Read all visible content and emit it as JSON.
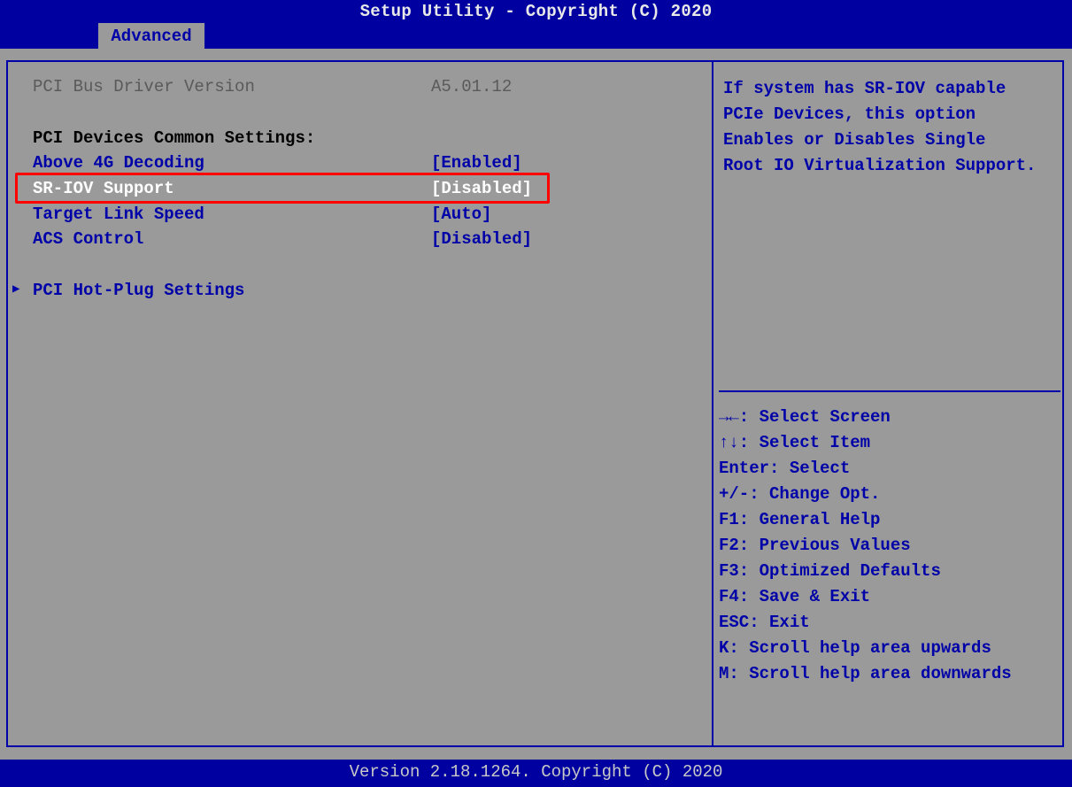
{
  "header": {
    "title": "Setup Utility - Copyright (C) 2020",
    "active_tab": "Advanced"
  },
  "main": {
    "info": {
      "label": "PCI Bus Driver Version",
      "value": "A5.01.12"
    },
    "section_heading": "PCI Devices Common Settings:",
    "settings": [
      {
        "label": "Above 4G Decoding",
        "value": "[Enabled]"
      },
      {
        "label": "SR-IOV Support",
        "value": "[Disabled]",
        "selected": true
      },
      {
        "label": "Target Link Speed",
        "value": "[Auto]"
      },
      {
        "label": "ACS Control",
        "value": "[Disabled]"
      }
    ],
    "submenu": {
      "label": "PCI Hot-Plug Settings",
      "icon": "triangle-right-icon"
    }
  },
  "help": {
    "lines": [
      "If system has SR-IOV capable",
      "PCIe Devices, this option",
      "Enables or Disables Single",
      "Root IO Virtualization Support."
    ]
  },
  "keys": [
    "→←: Select Screen",
    "↑↓: Select Item",
    "Enter: Select",
    "+/-: Change Opt.",
    "F1: General Help",
    "F2: Previous Values",
    "F3: Optimized Defaults",
    "F4: Save & Exit",
    "ESC: Exit",
    "K: Scroll help area upwards",
    "M: Scroll help area downwards"
  ],
  "footer": {
    "text": "Version 2.18.1264. Copyright (C) 2020"
  },
  "colors": {
    "header_bg": "#0000a0",
    "body_bg": "#9a9a9a",
    "accent_blue": "#0000a8",
    "highlight_border": "#ff0000"
  }
}
